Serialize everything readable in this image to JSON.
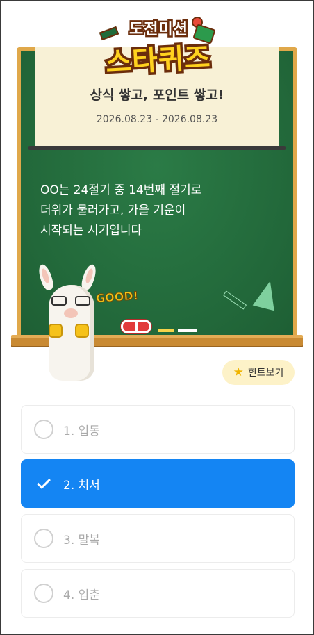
{
  "header": {
    "logo_top": "도전미션",
    "logo_main": "스타퀴즈"
  },
  "board": {
    "title": "상식 쌓고, 포인트 쌓고!",
    "date_range": "2026.08.23 - 2026.08.23",
    "question_lines": [
      "OO는 24절기 중 14번째 절기로",
      "더위가 물러가고, 가을 기운이",
      "시작되는 시기입니다"
    ],
    "sticker": "GOOD!"
  },
  "hint": {
    "label": "힌트보기",
    "icon": "star-icon"
  },
  "options": [
    {
      "label": "1. 입동",
      "selected": false
    },
    {
      "label": "2. 처서",
      "selected": true
    },
    {
      "label": "3. 말복",
      "selected": false
    },
    {
      "label": "4. 입춘",
      "selected": false
    }
  ],
  "colors": {
    "accent": "#1485f3",
    "board_green": "#25703d",
    "frame_wood": "#e0a84a",
    "hint_bg": "#fdf2c8"
  }
}
